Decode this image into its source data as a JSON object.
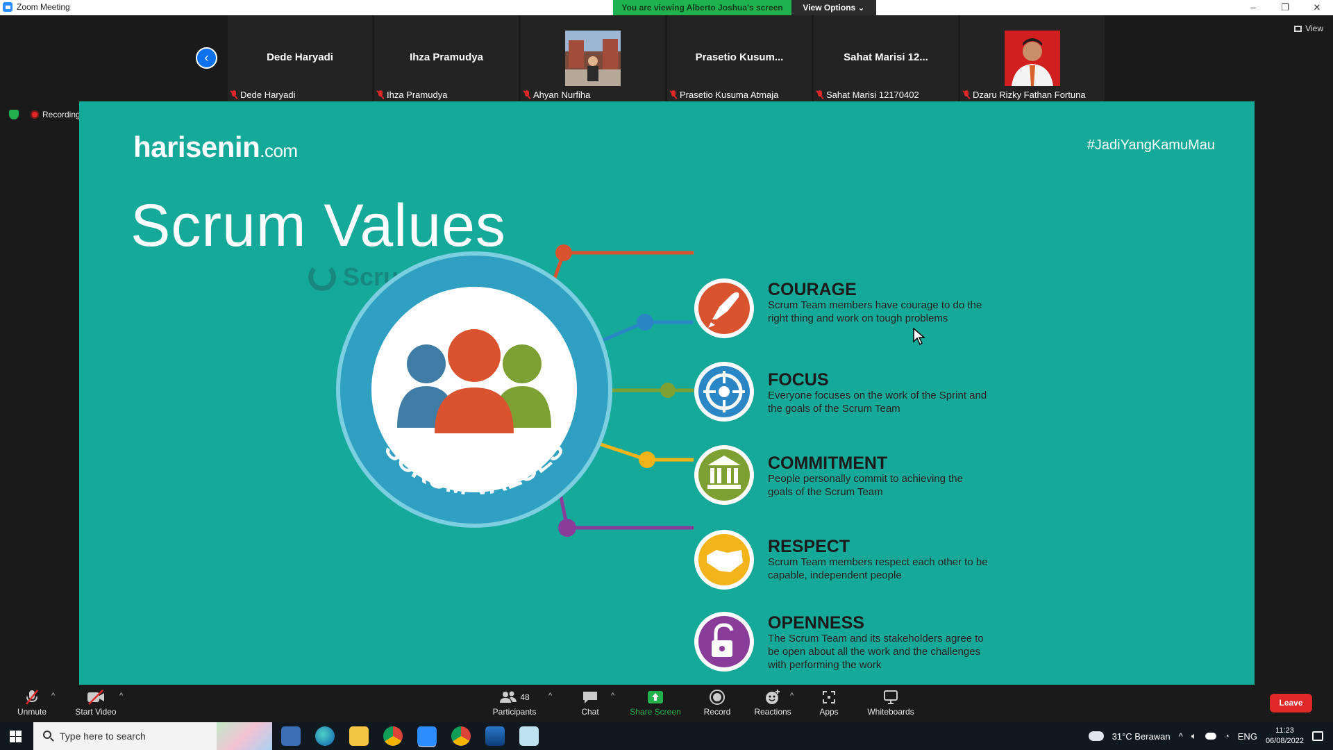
{
  "window": {
    "title": "Zoom Meeting",
    "viewing_banner": "You are viewing Alberto Joshua's screen",
    "view_options": "View Options ⌄",
    "controls": [
      "–",
      "❐",
      "✕"
    ]
  },
  "gallery": {
    "view_label": "View",
    "tiles": [
      {
        "display": "Dede Haryadi",
        "name": "Dede Haryadi"
      },
      {
        "display": "Ihza Pramudya",
        "name": "Ihza Pramudya"
      },
      {
        "display": "",
        "name": "Ahyan Nurfiha"
      },
      {
        "display": "Prasetio Kusum...",
        "name": "Prasetio Kusuma Atmaja"
      },
      {
        "display": "Sahat Marisi 12...",
        "name": "Sahat Marisi 12170402"
      },
      {
        "display": "",
        "name": "Dzaru Rizky Fathan Fortuna"
      }
    ]
  },
  "status": {
    "recording": "Recording"
  },
  "slide": {
    "brand_main": "harisenin",
    "brand_suffix": ".com",
    "hashtag": "#JadiYangKamuMau",
    "title": "Scrum Values",
    "source": "Scrum.org",
    "circle_label": "SCRUM VALUES",
    "values": [
      {
        "name": "COURAGE",
        "desc": "Scrum Team members have courage to do the right thing and work on tough problems",
        "color": "#d9532f"
      },
      {
        "name": "FOCUS",
        "desc": "Everyone focuses on the work of the Sprint and the goals of the Scrum Team",
        "color": "#2a86c5"
      },
      {
        "name": "COMMITMENT",
        "desc": "People personally commit to achieving the goals of the Scrum Team",
        "color": "#7ea032"
      },
      {
        "name": "RESPECT",
        "desc": "Scrum Team members respect each other to be capable, independent people",
        "color": "#f2b418"
      },
      {
        "name": "OPENNESS",
        "desc": "The Scrum Team and its stakeholders agree to be open about all the work and the challenges with performing the work",
        "color": "#8a3c9b"
      }
    ]
  },
  "toolbar": {
    "unmute": "Unmute",
    "start_video": "Start Video",
    "participants": "Participants",
    "participant_count": "48",
    "chat": "Chat",
    "share_screen": "Share Screen",
    "record": "Record",
    "reactions": "Reactions",
    "apps": "Apps",
    "whiteboards": "Whiteboards",
    "leave": "Leave"
  },
  "taskbar": {
    "search_placeholder": "Type here to search",
    "weather": "31°C  Berawan",
    "language": "ENG",
    "time": "11:23",
    "date": "06/08/2022"
  }
}
